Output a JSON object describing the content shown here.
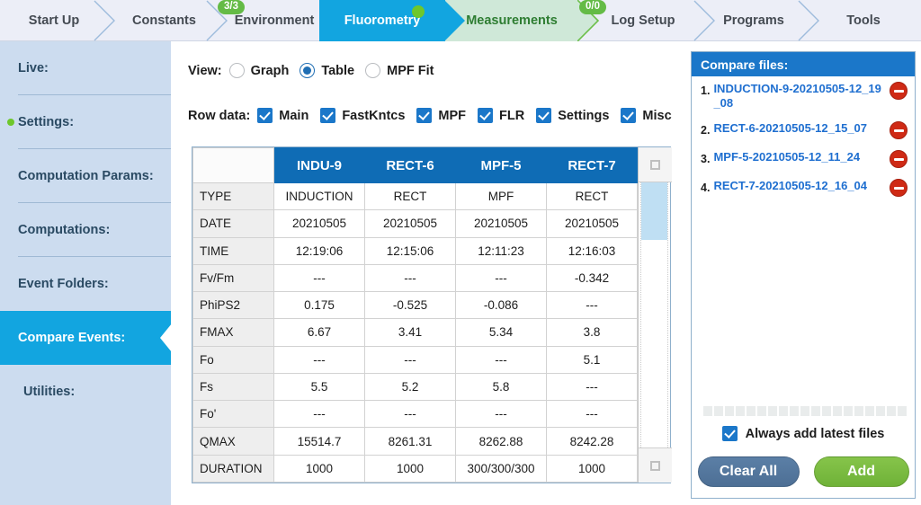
{
  "topnav": {
    "tabs": [
      {
        "label": "Start Up",
        "state": "plain",
        "badge": null
      },
      {
        "label": "Constants",
        "state": "plain",
        "badge": null
      },
      {
        "label": "Environment",
        "state": "plain",
        "badge": "3/3"
      },
      {
        "label": "Fluorometry",
        "state": "active",
        "badge": null
      },
      {
        "label": "Measurements",
        "state": "pending",
        "badge": null
      },
      {
        "label": "Log Setup",
        "state": "plain",
        "badge": "0/0"
      },
      {
        "label": "Programs",
        "state": "plain",
        "badge": null
      },
      {
        "label": "Tools",
        "state": "plain",
        "badge": null
      }
    ]
  },
  "sidebar": {
    "items": [
      {
        "label": "Live:",
        "active": false,
        "dot": false
      },
      {
        "label": "Settings:",
        "active": false,
        "dot": true
      },
      {
        "label": "Computation Params:",
        "active": false,
        "dot": false
      },
      {
        "label": "Computations:",
        "active": false,
        "dot": false
      },
      {
        "label": "Event Folders:",
        "active": false,
        "dot": false
      },
      {
        "label": "Compare Events:",
        "active": true,
        "dot": false
      },
      {
        "label": "Utilities:",
        "active": false,
        "dot": false
      }
    ]
  },
  "controls": {
    "view_label": "View:",
    "view_options": [
      {
        "label": "Graph",
        "selected": false
      },
      {
        "label": "Table",
        "selected": true
      },
      {
        "label": "MPF Fit",
        "selected": false
      }
    ],
    "rowdata_label": "Row data:",
    "rowdata_options": [
      {
        "label": "Main",
        "checked": true
      },
      {
        "label": "FastKntcs",
        "checked": true
      },
      {
        "label": "MPF",
        "checked": true
      },
      {
        "label": "FLR",
        "checked": true
      },
      {
        "label": "Settings",
        "checked": true
      },
      {
        "label": "Misc",
        "checked": true
      }
    ]
  },
  "table": {
    "corner": "",
    "columns": [
      "INDU-9",
      "RECT-6",
      "MPF-5",
      "RECT-7"
    ],
    "rows": [
      {
        "label": "TYPE",
        "values": [
          "INDUCTION",
          "RECT",
          "MPF",
          "RECT"
        ]
      },
      {
        "label": "DATE",
        "values": [
          "20210505",
          "20210505",
          "20210505",
          "20210505"
        ]
      },
      {
        "label": "TIME",
        "values": [
          "12:19:06",
          "12:15:06",
          "12:11:23",
          "12:16:03"
        ]
      },
      {
        "label": "Fv/Fm",
        "values": [
          "---",
          "---",
          "---",
          "-0.342"
        ]
      },
      {
        "label": "PhiPS2",
        "values": [
          "0.175",
          "-0.525",
          "-0.086",
          "---"
        ]
      },
      {
        "label": "FMAX",
        "values": [
          "6.67",
          "3.41",
          "5.34",
          "3.8"
        ]
      },
      {
        "label": "Fo",
        "values": [
          "---",
          "---",
          "---",
          "5.1"
        ]
      },
      {
        "label": "Fs",
        "values": [
          "5.5",
          "5.2",
          "5.8",
          "---"
        ]
      },
      {
        "label": "Fo'",
        "values": [
          "---",
          "---",
          "---",
          "---"
        ]
      },
      {
        "label": "QMAX",
        "values": [
          "15514.7",
          "8261.31",
          "8262.88",
          "8242.28"
        ]
      },
      {
        "label": "DURATION",
        "values": [
          "1000",
          "1000",
          "300/300/300",
          "1000"
        ]
      }
    ]
  },
  "compare": {
    "title": "Compare files:",
    "files": [
      {
        "num": "1.",
        "name": "INDUCTION-9-20210505-12_19_08"
      },
      {
        "num": "2.",
        "name": "RECT-6-20210505-12_15_07"
      },
      {
        "num": "3.",
        "name": "MPF-5-20210505-12_11_24"
      },
      {
        "num": "4.",
        "name": "RECT-7-20210505-12_16_04"
      }
    ],
    "always_add_label": "Always add latest files",
    "always_add_checked": true,
    "clear_label": "Clear All",
    "add_label": "Add"
  },
  "colors": {
    "accent_blue": "#12a5e0",
    "header_blue": "#0f6cb5",
    "panel_blue": "#1b77c9",
    "green": "#64bb46",
    "pending_green_bg": "#cfe8d8",
    "pending_green_fg": "#2e7d32",
    "sidebar_bg": "#ccdcef",
    "link_blue": "#1f6fd0",
    "delete_red": "#cf2a15",
    "scroll_thumb": "#bfdff3"
  }
}
